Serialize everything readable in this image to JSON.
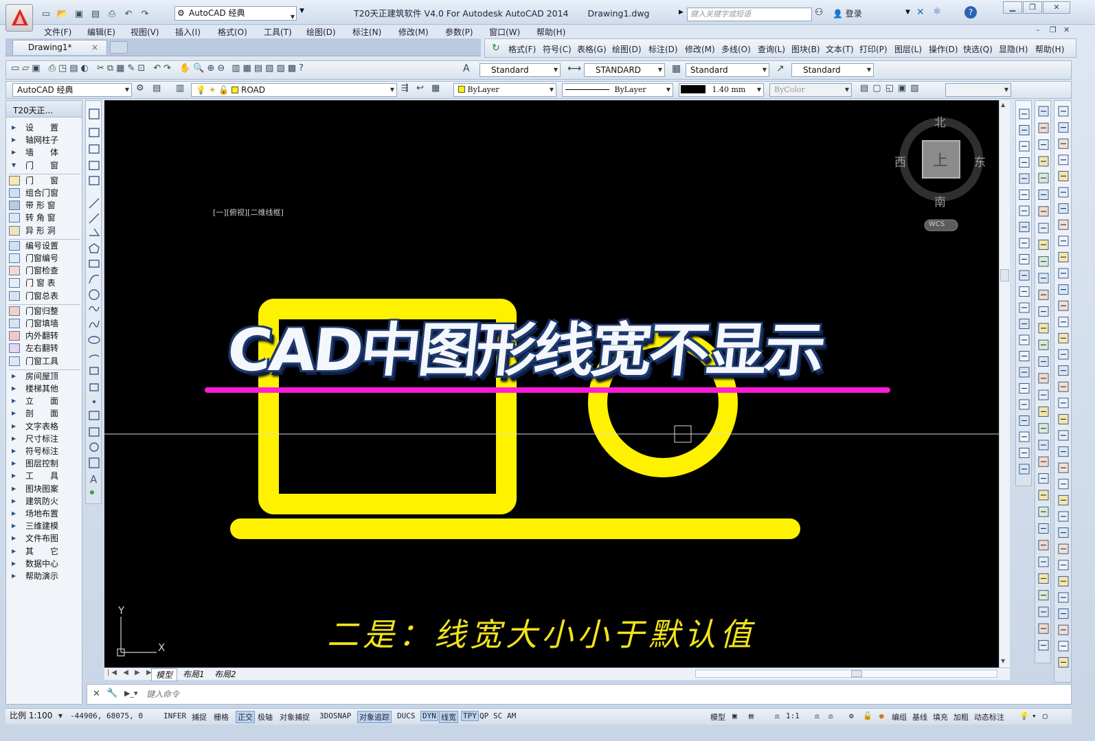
{
  "titlebar": {
    "workspace": "AutoCAD 经典",
    "app_title": "T20天正建筑软件 V4.0 For Autodesk AutoCAD 2014",
    "doc_title": "Drawing1.dwg",
    "search_placeholder": "键入关键字或短语",
    "login": "登录"
  },
  "menubar": [
    "文件(F)",
    "编辑(E)",
    "视图(V)",
    "插入(I)",
    "格式(O)",
    "工具(T)",
    "绘图(D)",
    "标注(N)",
    "修改(M)",
    "参数(P)",
    "窗口(W)",
    "帮助(H)"
  ],
  "tabs": {
    "doc_tab": "Drawing1*",
    "close": "×"
  },
  "t20menu": [
    "格式(F)",
    "符号(C)",
    "表格(G)",
    "绘图(D)",
    "标注(D)",
    "修改(M)",
    "多线(O)",
    "查询(L)",
    "图块(B)",
    "文本(T)",
    "打印(P)",
    "图层(L)",
    "操作(D)",
    "快选(Q)",
    "显隐(H)",
    "帮助(H)"
  ],
  "styles_toolbar": {
    "text_style": "Standard",
    "dim_style": "STANDARD",
    "table_style": "Standard",
    "mleader_style": "Standard"
  },
  "layers_toolbar": {
    "workspace": "AutoCAD 经典",
    "layer": "ROAD",
    "color": "ByLayer",
    "linetype": "ByLayer",
    "lineweight": "1.40 mm",
    "plotstyle": "ByColor"
  },
  "left_panel": {
    "header": "T20天正...",
    "groups": [
      {
        "label": "设　　置",
        "type": "closed"
      },
      {
        "label": "轴网柱子",
        "type": "closed"
      },
      {
        "label": "墙　　体",
        "type": "closed"
      },
      {
        "label": "门　　窗",
        "type": "open"
      }
    ],
    "sub1": [
      "门　　窗",
      "组合门窗",
      "带 形 窗",
      "转 角 窗",
      "异 形 洞"
    ],
    "sub2": [
      "编号设置",
      "门窗编号",
      "门窗检查",
      "门 窗 表",
      "门窗总表"
    ],
    "sub3": [
      "门窗归整",
      "门窗填墙",
      "内外翻转",
      "左右翻转",
      "门窗工具"
    ],
    "groups2": [
      "房间屋顶",
      "楼梯其他",
      "立　　面",
      "剖　　面",
      "文字表格",
      "尺寸标注",
      "符号标注",
      "图层控制",
      "工　　具",
      "图块图案",
      "建筑防火",
      "场地布置",
      "三维建模",
      "文件布图",
      "其　　它",
      "数据中心",
      "帮助演示"
    ]
  },
  "viewport": {
    "label": "[一][俯视][二维线框]",
    "viewcube": {
      "north": "北",
      "south": "南",
      "east": "东",
      "west": "西",
      "top": "上",
      "wcs": "WCS"
    },
    "ucs": {
      "x": "X",
      "y": "Y"
    },
    "overlay_title": "CAD中图形线宽不显示",
    "subtitle": "二是：线宽大小小于默认值"
  },
  "layout_tabs": [
    "模型",
    "布局1",
    "布局2"
  ],
  "command": {
    "placeholder": "键入命令"
  },
  "status": {
    "scale": "比例 1:100",
    "coords": "-44906, 68075, 0",
    "toggles": [
      {
        "label": "INFER",
        "on": false
      },
      {
        "label": "捕捉",
        "on": false
      },
      {
        "label": "栅格",
        "on": false
      },
      {
        "label": "正交",
        "on": true
      },
      {
        "label": "极轴",
        "on": false
      },
      {
        "label": "对象捕捉",
        "on": false
      },
      {
        "label": "3DOSNAP",
        "on": false
      },
      {
        "label": "对象追踪",
        "on": true
      },
      {
        "label": "DUCS",
        "on": false
      },
      {
        "label": "DYN",
        "on": true
      },
      {
        "label": "线宽",
        "on": true
      },
      {
        "label": "TPY",
        "on": true
      },
      {
        "label": "QP",
        "on": false
      },
      {
        "label": "SC",
        "on": false
      },
      {
        "label": "AM",
        "on": false
      }
    ],
    "model": "模型",
    "anno_scale": "1:1",
    "right_items": [
      "编组",
      "基线",
      "填充",
      "加粗",
      "动态标注"
    ]
  },
  "colors": {
    "yellow": "#fff200",
    "magenta": "#ff1cd6",
    "accent": "#3a6fb8"
  }
}
